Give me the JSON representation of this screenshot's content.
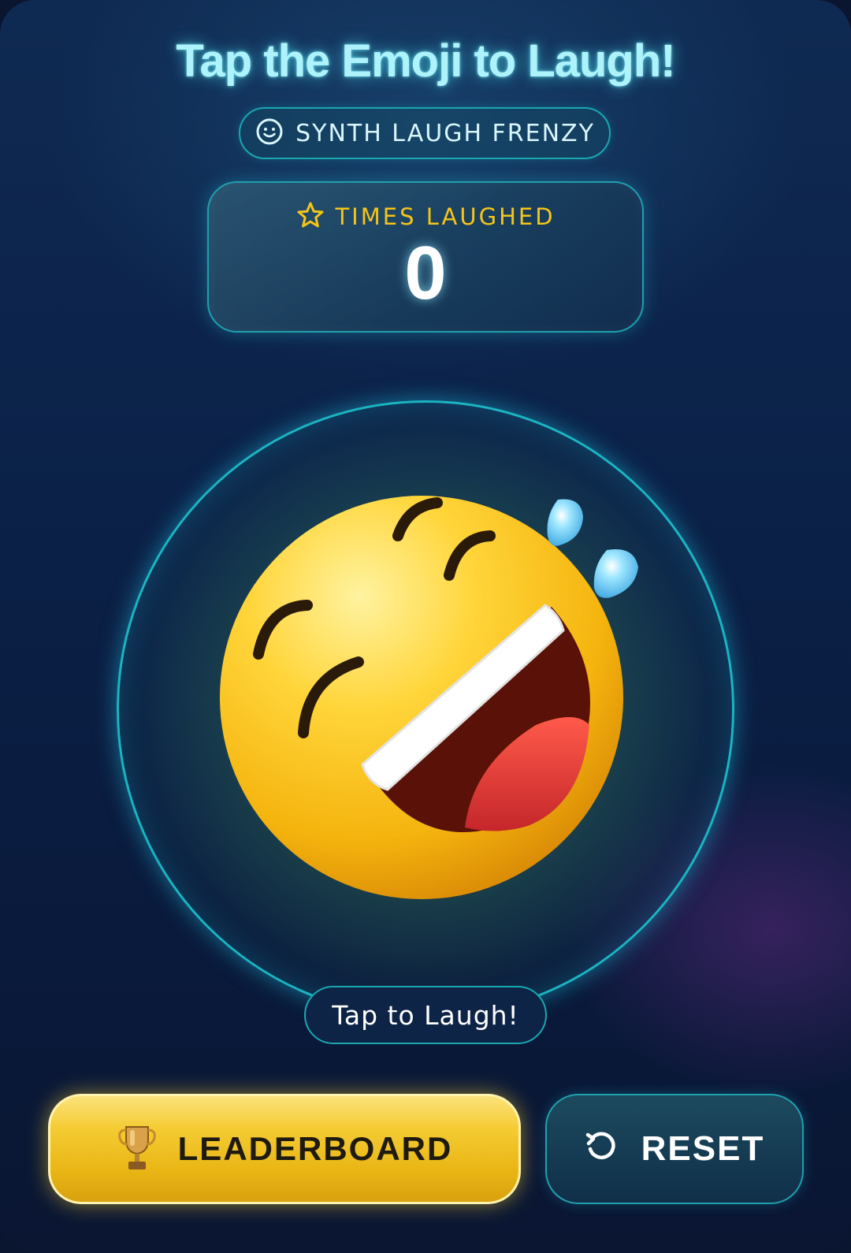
{
  "header": {
    "title": "Tap the Emoji to Laugh!"
  },
  "mode": {
    "label": "SYNTH LAUGH FRENZY",
    "icon": "smiley-icon"
  },
  "score": {
    "label": "TIMES LAUGHED",
    "icon": "star-icon",
    "value": "0"
  },
  "emoji": {
    "name": "rolling-on-floor-laughing-emoji"
  },
  "tap_hint": {
    "label": "Tap to Laugh!"
  },
  "actions": {
    "leaderboard_label": "LEADERBOARD",
    "leaderboard_icon": "trophy-icon",
    "reset_label": "RESET",
    "reset_icon": "refresh-icon"
  },
  "colors": {
    "accent_cyan": "#1bb4c2",
    "title_glow": "#aef3fb",
    "score_label": "#f5c518",
    "leaderboard_gold": "#f5cc34"
  }
}
